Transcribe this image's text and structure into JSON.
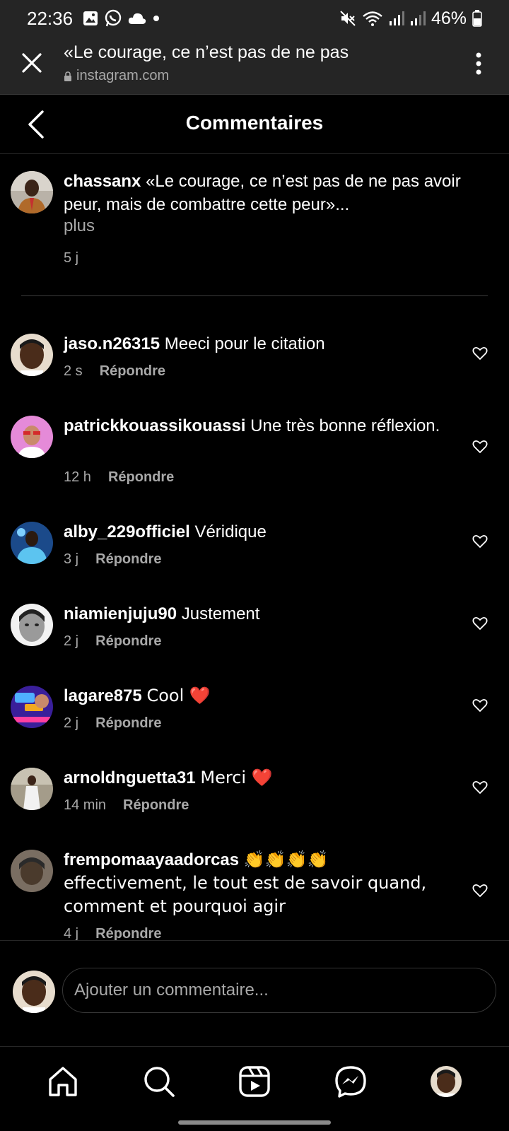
{
  "status_bar": {
    "time": "22:36",
    "battery": "46%",
    "icons": [
      "gallery-icon",
      "whatsapp-icon",
      "cloud-icon",
      "dot-icon",
      "mute-icon",
      "wifi-icon",
      "signal-icon",
      "signal-icon",
      "battery-icon"
    ]
  },
  "browser": {
    "title": "«Le courage, ce n’est pas de ne pas",
    "url": "instagram.com"
  },
  "header": {
    "title": "Commentaires"
  },
  "caption": {
    "username": "chassanx",
    "text": "«Le courage, ce n’est pas de ne pas avoir peur, mais de combattre cette peur»...",
    "more": "plus",
    "time": "5 j"
  },
  "comments": [
    {
      "username": "jaso.n26315",
      "text": "Meeci pour le citation",
      "time": "2 s",
      "reply": "Répondre",
      "avatar_color": "#5a3b22"
    },
    {
      "username": "patrickkouassikouassi",
      "text": "Une très bonne réflexion.",
      "time": "12 h",
      "reply": "Répondre",
      "avatar_color": "#d36bc7"
    },
    {
      "username": "alby_229officiel",
      "text": "Véridique",
      "time": "3 j",
      "reply": "Répondre",
      "avatar_color": "#2c8fc9"
    },
    {
      "username": "niamienjuju90",
      "text": "Justement",
      "time": "2 j",
      "reply": "Répondre",
      "avatar_color": "#cfcfcf"
    },
    {
      "username": "lagare875",
      "text": "Cool ❤️",
      "time": "2 j",
      "reply": "Répondre",
      "avatar_color": "#4a2bb8"
    },
    {
      "username": "arnoldnguetta31",
      "text": "Merci ❤️",
      "time": "14 min",
      "reply": "Répondre",
      "avatar_color": "#9a9486"
    },
    {
      "username": "frempomaayaadorcas",
      "text": "👏👏👏👏 effectivement, le tout est de savoir quand, comment et pourquoi agir",
      "time": "4 j",
      "reply": "Répondre",
      "avatar_color": "#6e6358"
    }
  ],
  "input": {
    "placeholder": "Ajouter un commentaire..."
  },
  "colors": {
    "background": "#000000",
    "bar": "#252525",
    "muted_text": "#a8a8a8",
    "heart_red": "#ed1c2b"
  }
}
